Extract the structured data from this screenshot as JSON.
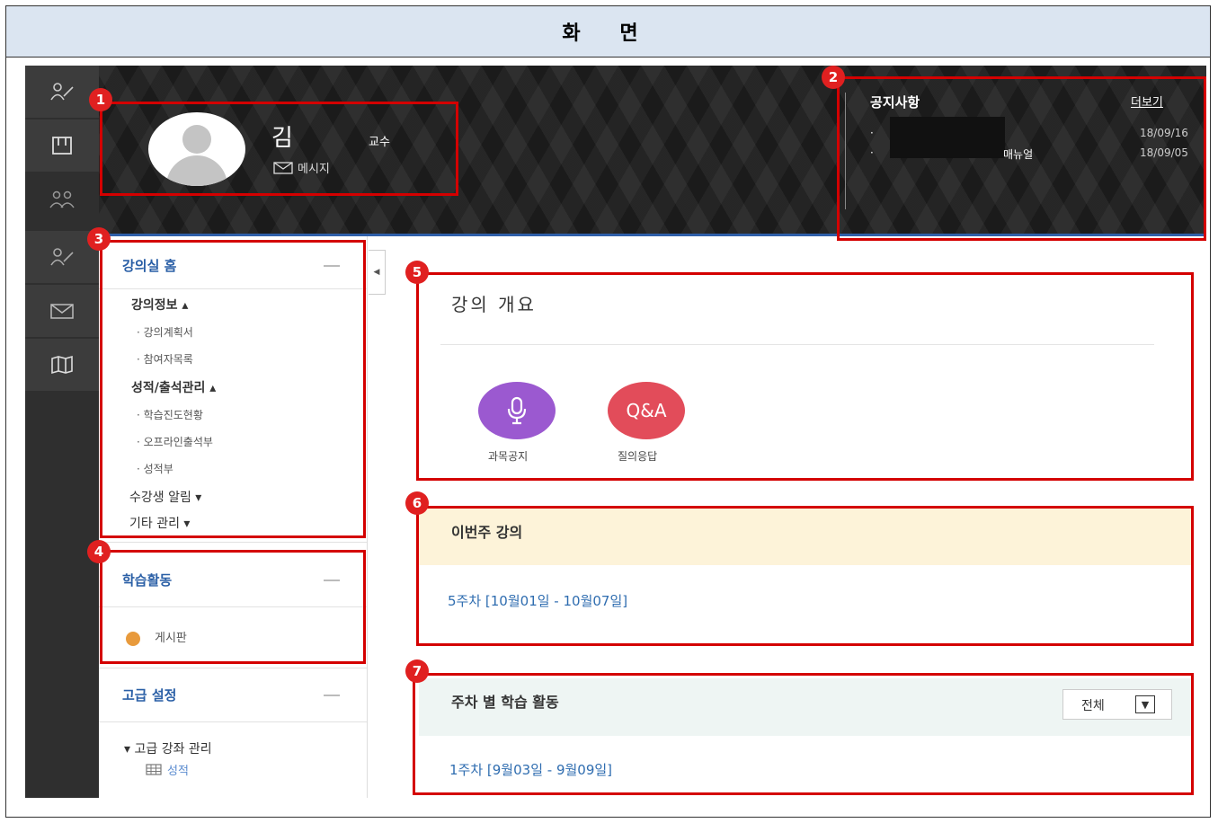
{
  "screen_title": "화 면",
  "rail": {
    "icons": [
      "users-icon",
      "book-icon",
      "group-icon",
      "user-edit-icon",
      "mail-icon",
      "map-icon"
    ]
  },
  "header": {
    "professor_name": "김",
    "professor_role": "교수",
    "message_label": "메시지"
  },
  "notice": {
    "title": "공지사항",
    "more_label": "더보기",
    "items": [
      {
        "bullet": "·",
        "text": "",
        "date": "18/09/16"
      },
      {
        "bullet": "·",
        "text": "매뉴얼",
        "date": "18/09/05"
      }
    ]
  },
  "sidebar": {
    "home_title": "강의실 홈",
    "groups": [
      {
        "label": "강의정보 ▴",
        "subs": [
          "· 강의계획서",
          "· 참여자목록"
        ]
      },
      {
        "label": "성적/출석관리 ▴",
        "subs": [
          "· 학습진도현황",
          "· 오프라인출석부",
          "· 성적부"
        ]
      }
    ],
    "plain_groups": [
      "수강생 알림 ▾",
      "기타 관리 ▾"
    ],
    "learning_title": "학습활동",
    "board_label": "게시판",
    "advanced_title": "고급 설정",
    "advanced_item": "▾ 고급 강좌 관리",
    "advanced_sub": "성적"
  },
  "overview": {
    "title": "강의 개요",
    "buttons": [
      {
        "icon": "microphone-icon",
        "label": "과목공지",
        "color": "#9b59d0"
      },
      {
        "icon": "qa-icon",
        "text": "Q&A",
        "label": "질의응답",
        "color": "#e24c5a"
      }
    ]
  },
  "this_week": {
    "title": "이번주 강의",
    "link": "5주차 [10월01일 - 10월07일]"
  },
  "weekly": {
    "title": "주차 별 학습 활동",
    "filter": "전체",
    "link": "1주차 [9월03일 - 9월09일]"
  },
  "annotations": [
    "1",
    "2",
    "3",
    "4",
    "5",
    "6",
    "7"
  ]
}
